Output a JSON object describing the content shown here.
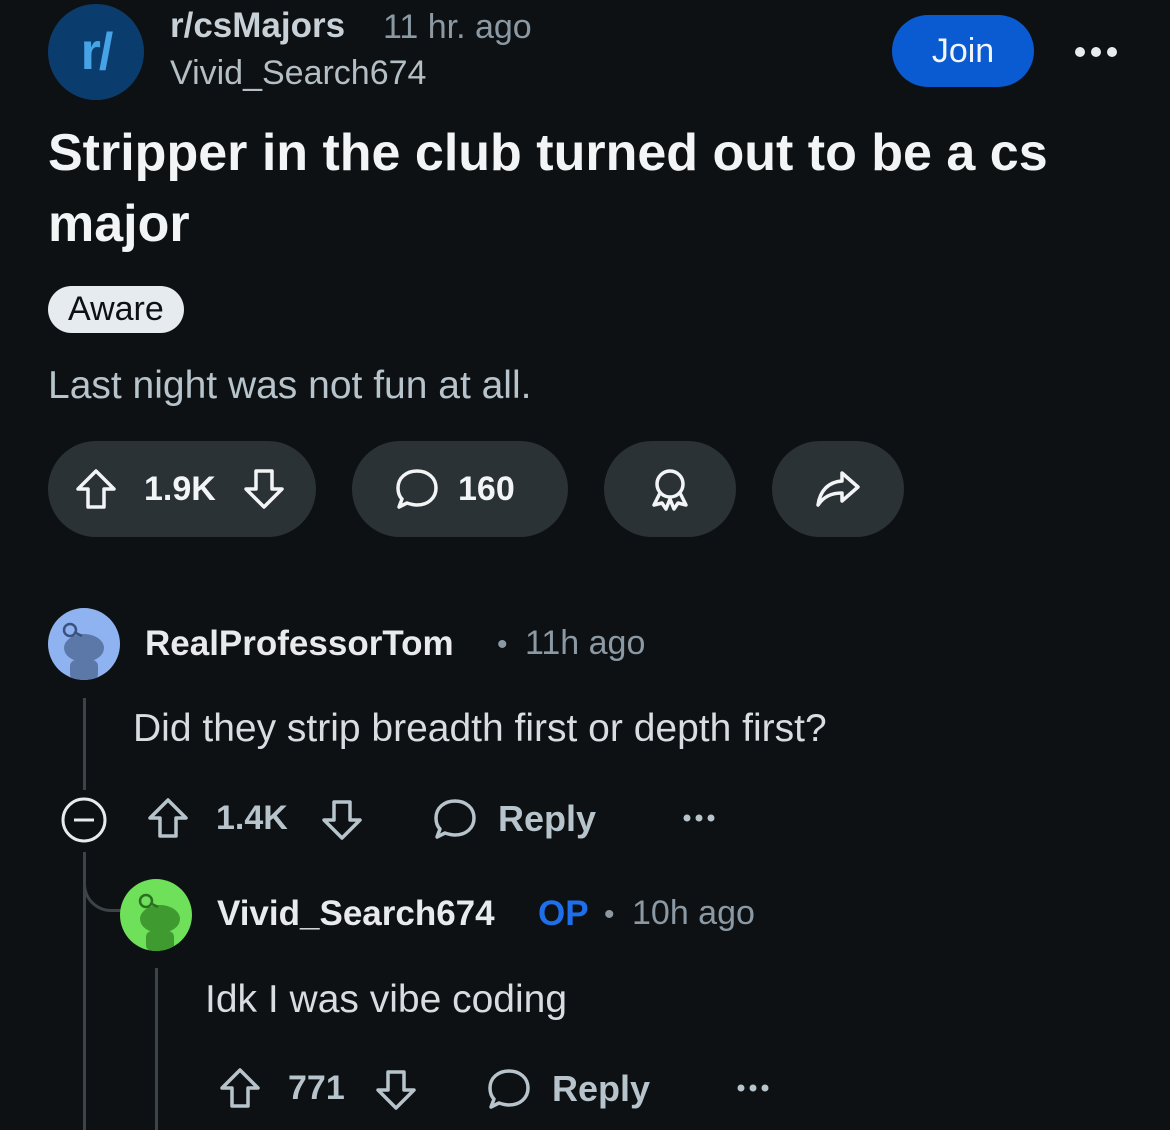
{
  "post": {
    "subreddit_icon": "r/",
    "subreddit": "r/csMajors",
    "time_ago": "11 hr. ago",
    "author": "Vivid_Search674",
    "join_label": "Join",
    "more_icon": "ellipsis-icon",
    "title": "Stripper in the club turned out to be a cs major",
    "flair": "Aware",
    "body": "Last night was not fun at all.",
    "upvotes": "1.9K",
    "comments": "160"
  },
  "comments": [
    {
      "user": "RealProfessorTom",
      "dot": "•",
      "time": "11h ago",
      "body": "Did they strip breadth first or depth first?",
      "votes": "1.4K",
      "reply_label": "Reply",
      "avatar_color": "#8fb3f0"
    },
    {
      "user": "Vivid_Search674",
      "op_badge": "OP",
      "dot": "•",
      "time": "10h ago",
      "body": "Idk I was vibe coding",
      "votes": "771",
      "reply_label": "Reply",
      "avatar_color": "#6ee05a"
    }
  ],
  "colors": {
    "background": "#0e1113",
    "join_button": "#0a5bd1",
    "pill": "#2a3236",
    "op_badge": "#1f6feb"
  }
}
